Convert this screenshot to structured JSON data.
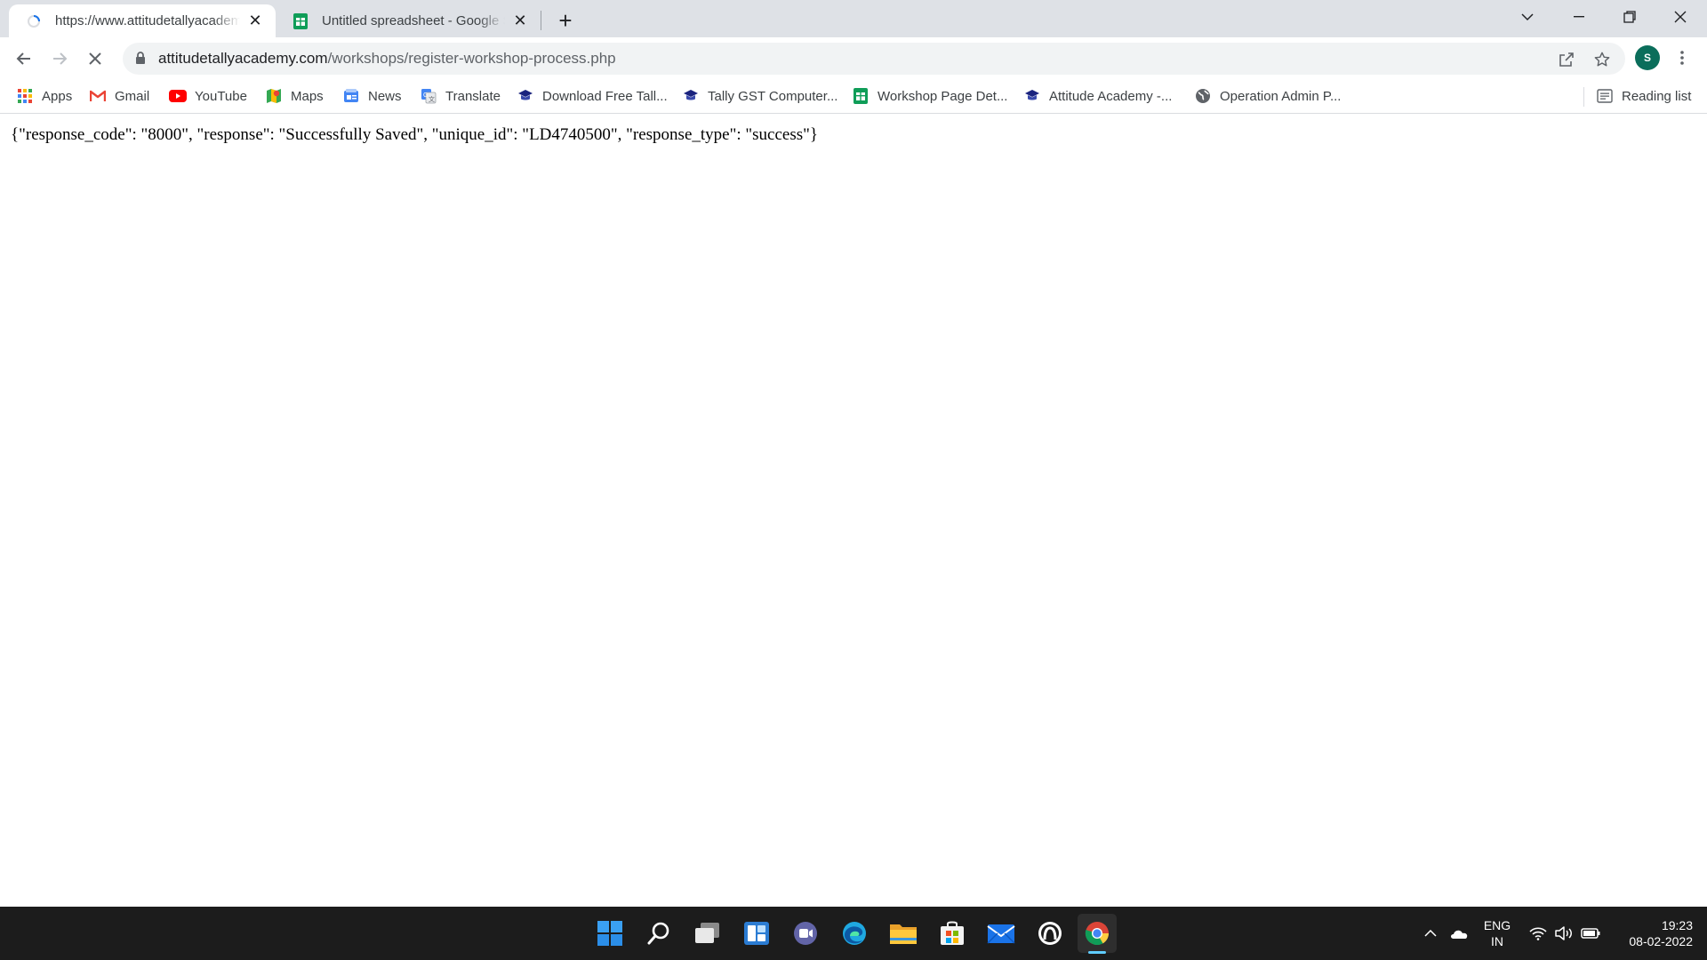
{
  "browser": {
    "tabs": [
      {
        "title": "https://www.attitudetallyacademy.com/workshops/register-workshop-process.php",
        "icon": "loading-throbber-icon",
        "active": true
      },
      {
        "title": "Untitled spreadsheet - Google Sheets",
        "icon": "google-sheets-icon",
        "active": false
      }
    ],
    "new_tab_label": "+",
    "url_host": "attitudetallyacademy.com",
    "url_path": "/workshops/register-workshop-process.php",
    "profile_initial": "S",
    "bookmarks": [
      {
        "label": "Apps",
        "icon": "apps-grid-icon"
      },
      {
        "label": "Gmail",
        "icon": "gmail-icon"
      },
      {
        "label": "YouTube",
        "icon": "youtube-icon"
      },
      {
        "label": "Maps",
        "icon": "maps-icon"
      },
      {
        "label": "News",
        "icon": "news-icon"
      },
      {
        "label": "Translate",
        "icon": "translate-icon"
      },
      {
        "label": "Download Free Tall...",
        "icon": "attitude-academy-icon"
      },
      {
        "label": "Tally GST Computer...",
        "icon": "attitude-academy-icon"
      },
      {
        "label": "Workshop Page Det...",
        "icon": "google-sheets-icon"
      },
      {
        "label": "Attitude Academy -...",
        "icon": "attitude-academy-icon"
      },
      {
        "label": "Operation Admin P...",
        "icon": "globe-icon"
      }
    ],
    "reading_list_label": "Reading list"
  },
  "page": {
    "json_response": "{\"response_code\": \"8000\", \"response\": \"Successfully Saved\", \"unique_id\": \"LD4740500\", \"response_type\": \"success\"}"
  },
  "taskbar": {
    "apps": [
      "windows-start-icon",
      "search-icon",
      "task-view-icon",
      "widgets-icon",
      "teams-chat-icon",
      "edge-icon",
      "file-explorer-icon",
      "microsoft-store-icon",
      "mail-icon",
      "app-icon",
      "chrome-icon"
    ],
    "language_line1": "ENG",
    "language_line2": "IN",
    "time": "19:23",
    "date": "08-02-2022"
  },
  "colors": {
    "tabstrip_bg": "#dee1e6",
    "taskbar_bg": "#1c1c1c",
    "profile_bg": "#0b6e5b",
    "sheets_green": "#0f9d58",
    "active_indicator": "#60cdff"
  }
}
